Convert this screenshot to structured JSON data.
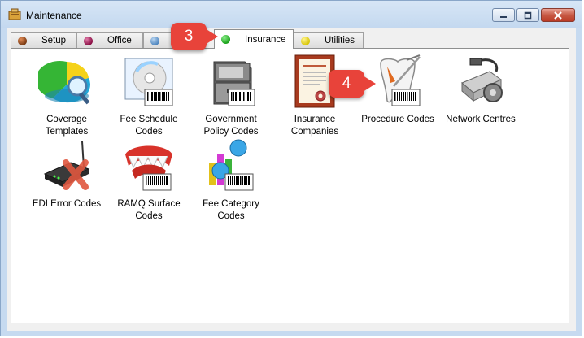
{
  "window": {
    "title": "Maintenance",
    "accent_color": "#c6daf0",
    "close_color": "#c75a45"
  },
  "tabs": [
    {
      "label": "Setup",
      "ball_color": "#7a3b14",
      "icon": "brown-ball-icon"
    },
    {
      "label": "Office",
      "ball_color": "#8a1045",
      "icon": "magenta-ball-icon"
    },
    {
      "label": "",
      "ball_color": "#4f86bf",
      "icon": "blue-ball-icon"
    },
    {
      "label": "Insurance",
      "ball_color": "#1aa11a",
      "icon": "green-ball-icon",
      "active": true
    },
    {
      "label": "Utilities",
      "ball_color": "#d8c60a",
      "icon": "yellow-ball-icon"
    }
  ],
  "items": [
    {
      "label": "Coverage\nTemplates",
      "icon": "coverage-templates-icon"
    },
    {
      "label": "Fee Schedule\nCodes",
      "icon": "fee-schedule-codes-icon"
    },
    {
      "label": "Government\nPolicy Codes",
      "icon": "government-policy-codes-icon"
    },
    {
      "label": "Insurance\nCompanies",
      "icon": "insurance-companies-icon"
    },
    {
      "label": "Procedure Codes",
      "icon": "procedure-codes-icon"
    },
    {
      "label": "Network Centres",
      "icon": "network-centres-icon"
    },
    {
      "label": "EDI Error Codes",
      "icon": "edi-error-codes-icon"
    },
    {
      "label": "RAMQ Surface\nCodes",
      "icon": "ramq-surface-codes-icon"
    },
    {
      "label": "Fee Category\nCodes",
      "icon": "fee-category-codes-icon"
    }
  ],
  "callouts": [
    {
      "number": "3",
      "color": "#e8433a"
    },
    {
      "number": "4",
      "color": "#e8433a"
    }
  ]
}
